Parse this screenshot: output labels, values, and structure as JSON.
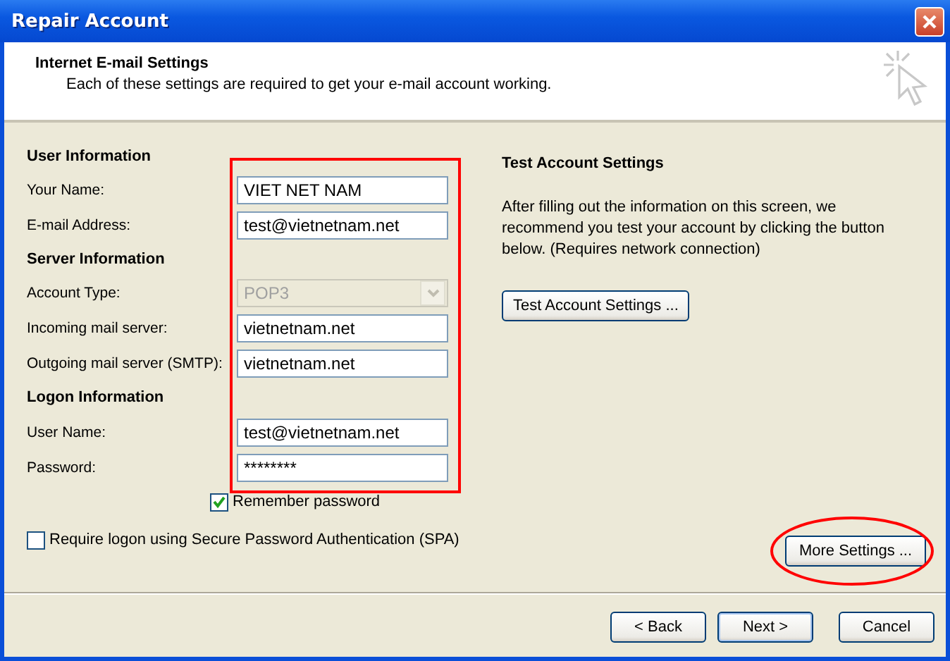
{
  "window": {
    "title": "Repair Account"
  },
  "header": {
    "title": "Internet E-mail Settings",
    "subtitle": "Each of these settings are required to get your e-mail account working."
  },
  "sections": [
    {
      "heading": "User Information",
      "fields": [
        {
          "label": "Your Name:",
          "value": "VIET NET NAM",
          "kind": "text",
          "disabled": false
        },
        {
          "label": "E-mail Address:",
          "value": "test@vietnetnam.net",
          "kind": "text",
          "disabled": false
        }
      ]
    },
    {
      "heading": "Server Information",
      "fields": [
        {
          "label": "Account Type:",
          "value": "POP3",
          "kind": "select",
          "disabled": true
        },
        {
          "label": "Incoming mail server:",
          "value": "vietnetnam.net",
          "kind": "text",
          "disabled": false
        },
        {
          "label": "Outgoing mail server (SMTP):",
          "value": "vietnetnam.net",
          "kind": "text",
          "disabled": false
        }
      ]
    },
    {
      "heading": "Logon Information",
      "fields": [
        {
          "label": "User Name:",
          "value": "test@vietnetnam.net",
          "kind": "text",
          "disabled": false
        },
        {
          "label": "Password:",
          "value": "********",
          "kind": "password",
          "disabled": false
        }
      ]
    }
  ],
  "remember_password": {
    "label": "Remember password",
    "checked": true
  },
  "spa": {
    "label": "Require logon using Secure Password Authentication (SPA)",
    "checked": false
  },
  "test": {
    "heading": "Test Account Settings",
    "text": "After filling out the information on this screen, we recommend you test your account by clicking the button below. (Requires network connection)",
    "button": "Test Account Settings ..."
  },
  "more_settings": "More Settings ...",
  "buttons": [
    {
      "label": "< Back",
      "default": false
    },
    {
      "label": "Next >",
      "default": true
    },
    {
      "label": "Cancel",
      "default": false
    }
  ]
}
